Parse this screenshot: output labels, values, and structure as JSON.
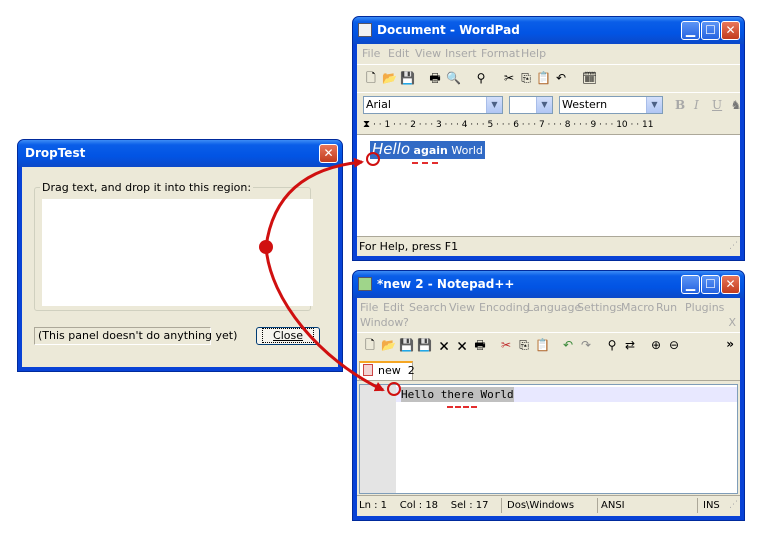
{
  "droptest": {
    "title": "DropTest",
    "group_label": "Drag text, and drop it into this region:",
    "status_text": "(This panel doesn't do anything yet)",
    "close_label": "Close"
  },
  "wordpad": {
    "title": "Document - WordPad",
    "menu": [
      "File",
      "Edit",
      "View",
      "Insert",
      "Format",
      "Help"
    ],
    "font_name": "Arial",
    "font_size": "",
    "script": "Western",
    "format_buttons": [
      "B",
      "I",
      "U"
    ],
    "ruler_text": "· · 1 · · · 2 · · · 3 · · · 4 · · · 5 · · · 6 · · · 7 · · · 8 · · · 9 · · · 10 · · 11",
    "doc_word1": "Hello",
    "doc_word2": "again",
    "doc_word3": "World",
    "status": "For Help, press F1"
  },
  "notepad": {
    "title": "*new  2 - Notepad++",
    "menu_row1": [
      "File",
      "Edit",
      "Search",
      "View",
      "Encoding",
      "Language",
      "Settings",
      "Macro",
      "Run",
      "Plugins"
    ],
    "menu_row2": [
      "Window",
      "?"
    ],
    "menu_close": "X",
    "overflow": "»",
    "tab_label": "new  2",
    "line_text": "Hello there World",
    "status": {
      "position": "Ln : 1    Col : 18    Sel : 17",
      "eol": "Dos\\Windows",
      "encoding": "ANSI",
      "mode": "INS"
    }
  },
  "colors": {
    "title_blue": "#0a5ee8",
    "selection": "#316ac5",
    "arrow_red": "#d01010",
    "dialog_bg": "#ece9d8"
  }
}
